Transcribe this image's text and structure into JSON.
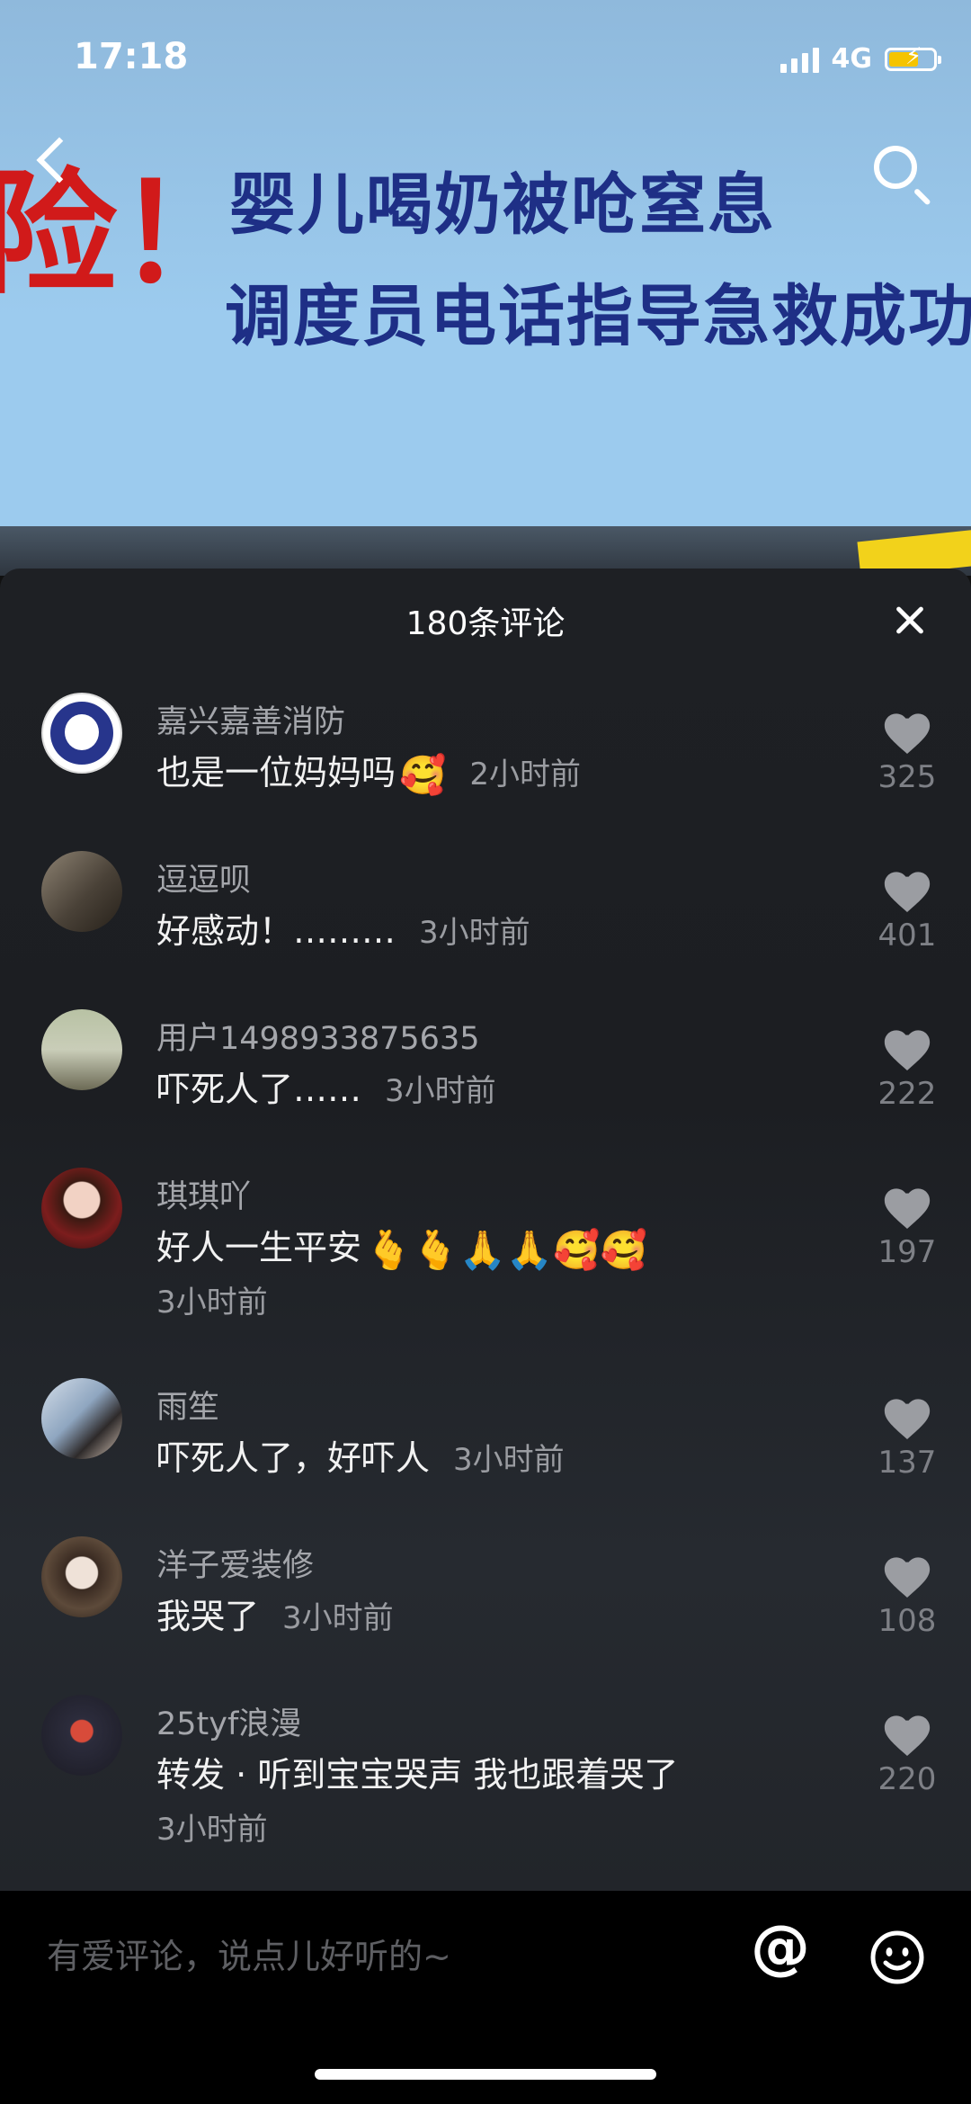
{
  "status_bar": {
    "time": "17:18",
    "network": "4G"
  },
  "video": {
    "line1": "婴儿喝奶被呛窒息",
    "line2": "调度员电话指导急救成功",
    "exclaim": "险！"
  },
  "sheet": {
    "title": "180条评论",
    "comments": [
      {
        "name": "嘉兴嘉善消防",
        "text": "也是一位妈妈吗",
        "emoji": "🥰",
        "time": "2小时前",
        "likes": "325"
      },
      {
        "name": "逗逗呗",
        "text": "好感动！………",
        "emoji": "",
        "time": "3小时前",
        "likes": "401"
      },
      {
        "name": "用户1498933875635",
        "text": "吓死人了……",
        "emoji": "",
        "time": "3小时前",
        "likes": "222"
      },
      {
        "name": "琪琪吖",
        "text": "好人一生平安",
        "emoji": "🫰🫰🙏🙏🥰🥰",
        "time": "3小时前",
        "likes": "197"
      },
      {
        "name": "雨笙",
        "text": "吓死人了，好吓人",
        "emoji": "",
        "time": "3小时前",
        "likes": "137"
      },
      {
        "name": "洋子爱装修",
        "text": "我哭了",
        "emoji": "",
        "time": "3小时前",
        "likes": "108"
      },
      {
        "name": "25tyf浪漫",
        "text": "转发 · 听到宝宝哭声 我也跟着哭了",
        "emoji": "",
        "time": "3小时前",
        "likes": "220"
      }
    ]
  },
  "input": {
    "placeholder": "有爱评论，说点儿好听的~",
    "at_symbol": "@"
  },
  "icons": [
    "back-icon",
    "search-icon",
    "close-icon",
    "heart-icon",
    "at-icon",
    "emoji-icon"
  ]
}
